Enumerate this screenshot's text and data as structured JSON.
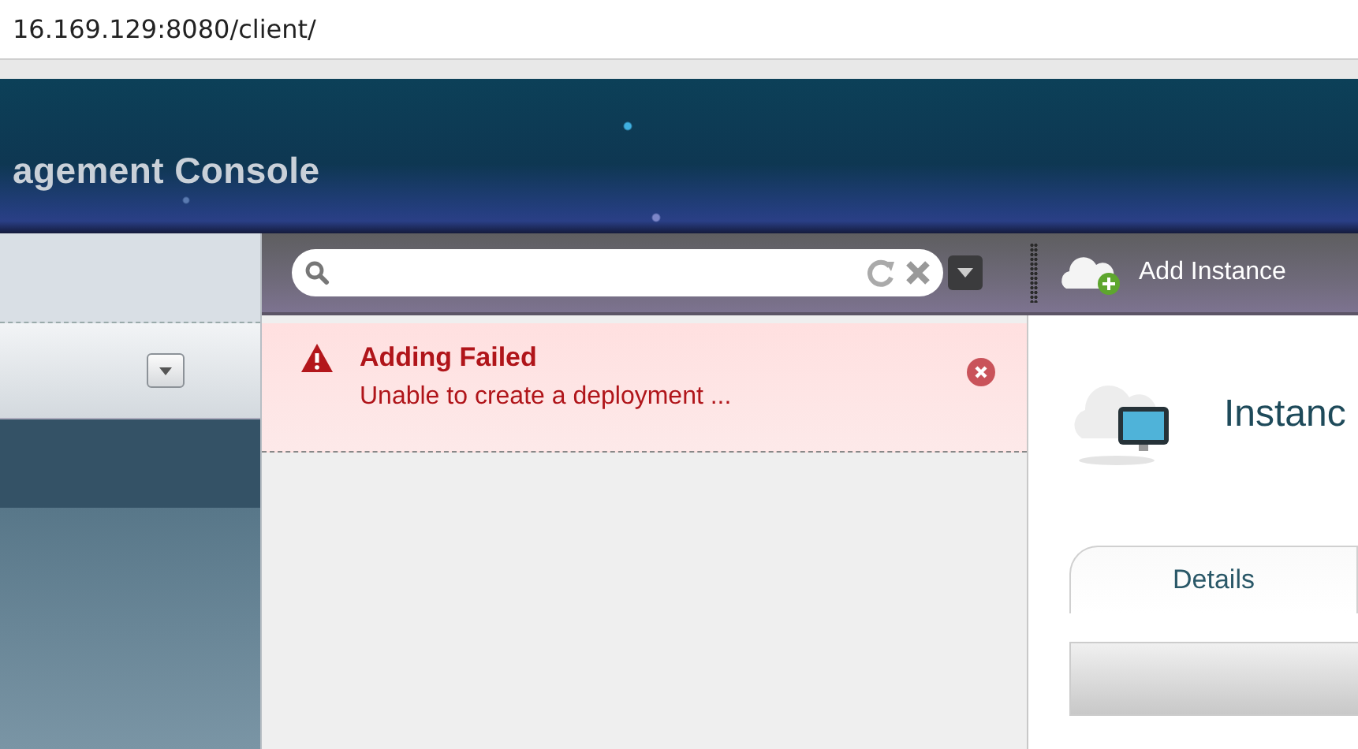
{
  "browser": {
    "url": "16.169.129:8080/client/"
  },
  "header": {
    "title": "agement Console"
  },
  "toolbar": {
    "add_button": "Add Instance"
  },
  "notification": {
    "title": "Adding Failed",
    "message": "Unable to create a deployment ..."
  },
  "detail": {
    "title": "Instanc",
    "tabs": [
      {
        "label": "Details",
        "selected": true
      }
    ]
  }
}
